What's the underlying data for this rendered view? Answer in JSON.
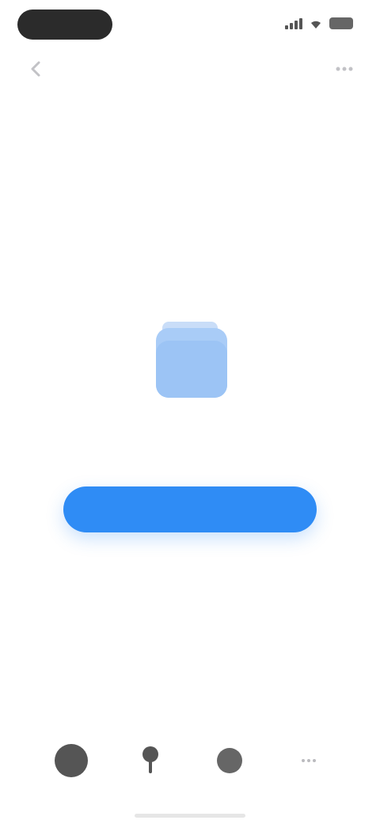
{
  "status_bar": {
    "icons": [
      "signal-icon",
      "wifi-icon",
      "battery-icon"
    ]
  },
  "top_nav": {
    "left_icon": "chevron-left-icon",
    "right_icon": "more-icon"
  },
  "empty_state": {
    "illustration": "folder-icon",
    "title": "",
    "subtitle": "",
    "button_label": ""
  },
  "tab_bar": {
    "items": [
      {
        "icon": "profile-icon"
      },
      {
        "icon": "pin-icon"
      },
      {
        "icon": "circle-icon"
      },
      {
        "icon": "more-icon"
      }
    ]
  },
  "colors": {
    "accent": "#2f8cf5",
    "illustration": "#a9ccf7",
    "background": "#ffffff"
  }
}
